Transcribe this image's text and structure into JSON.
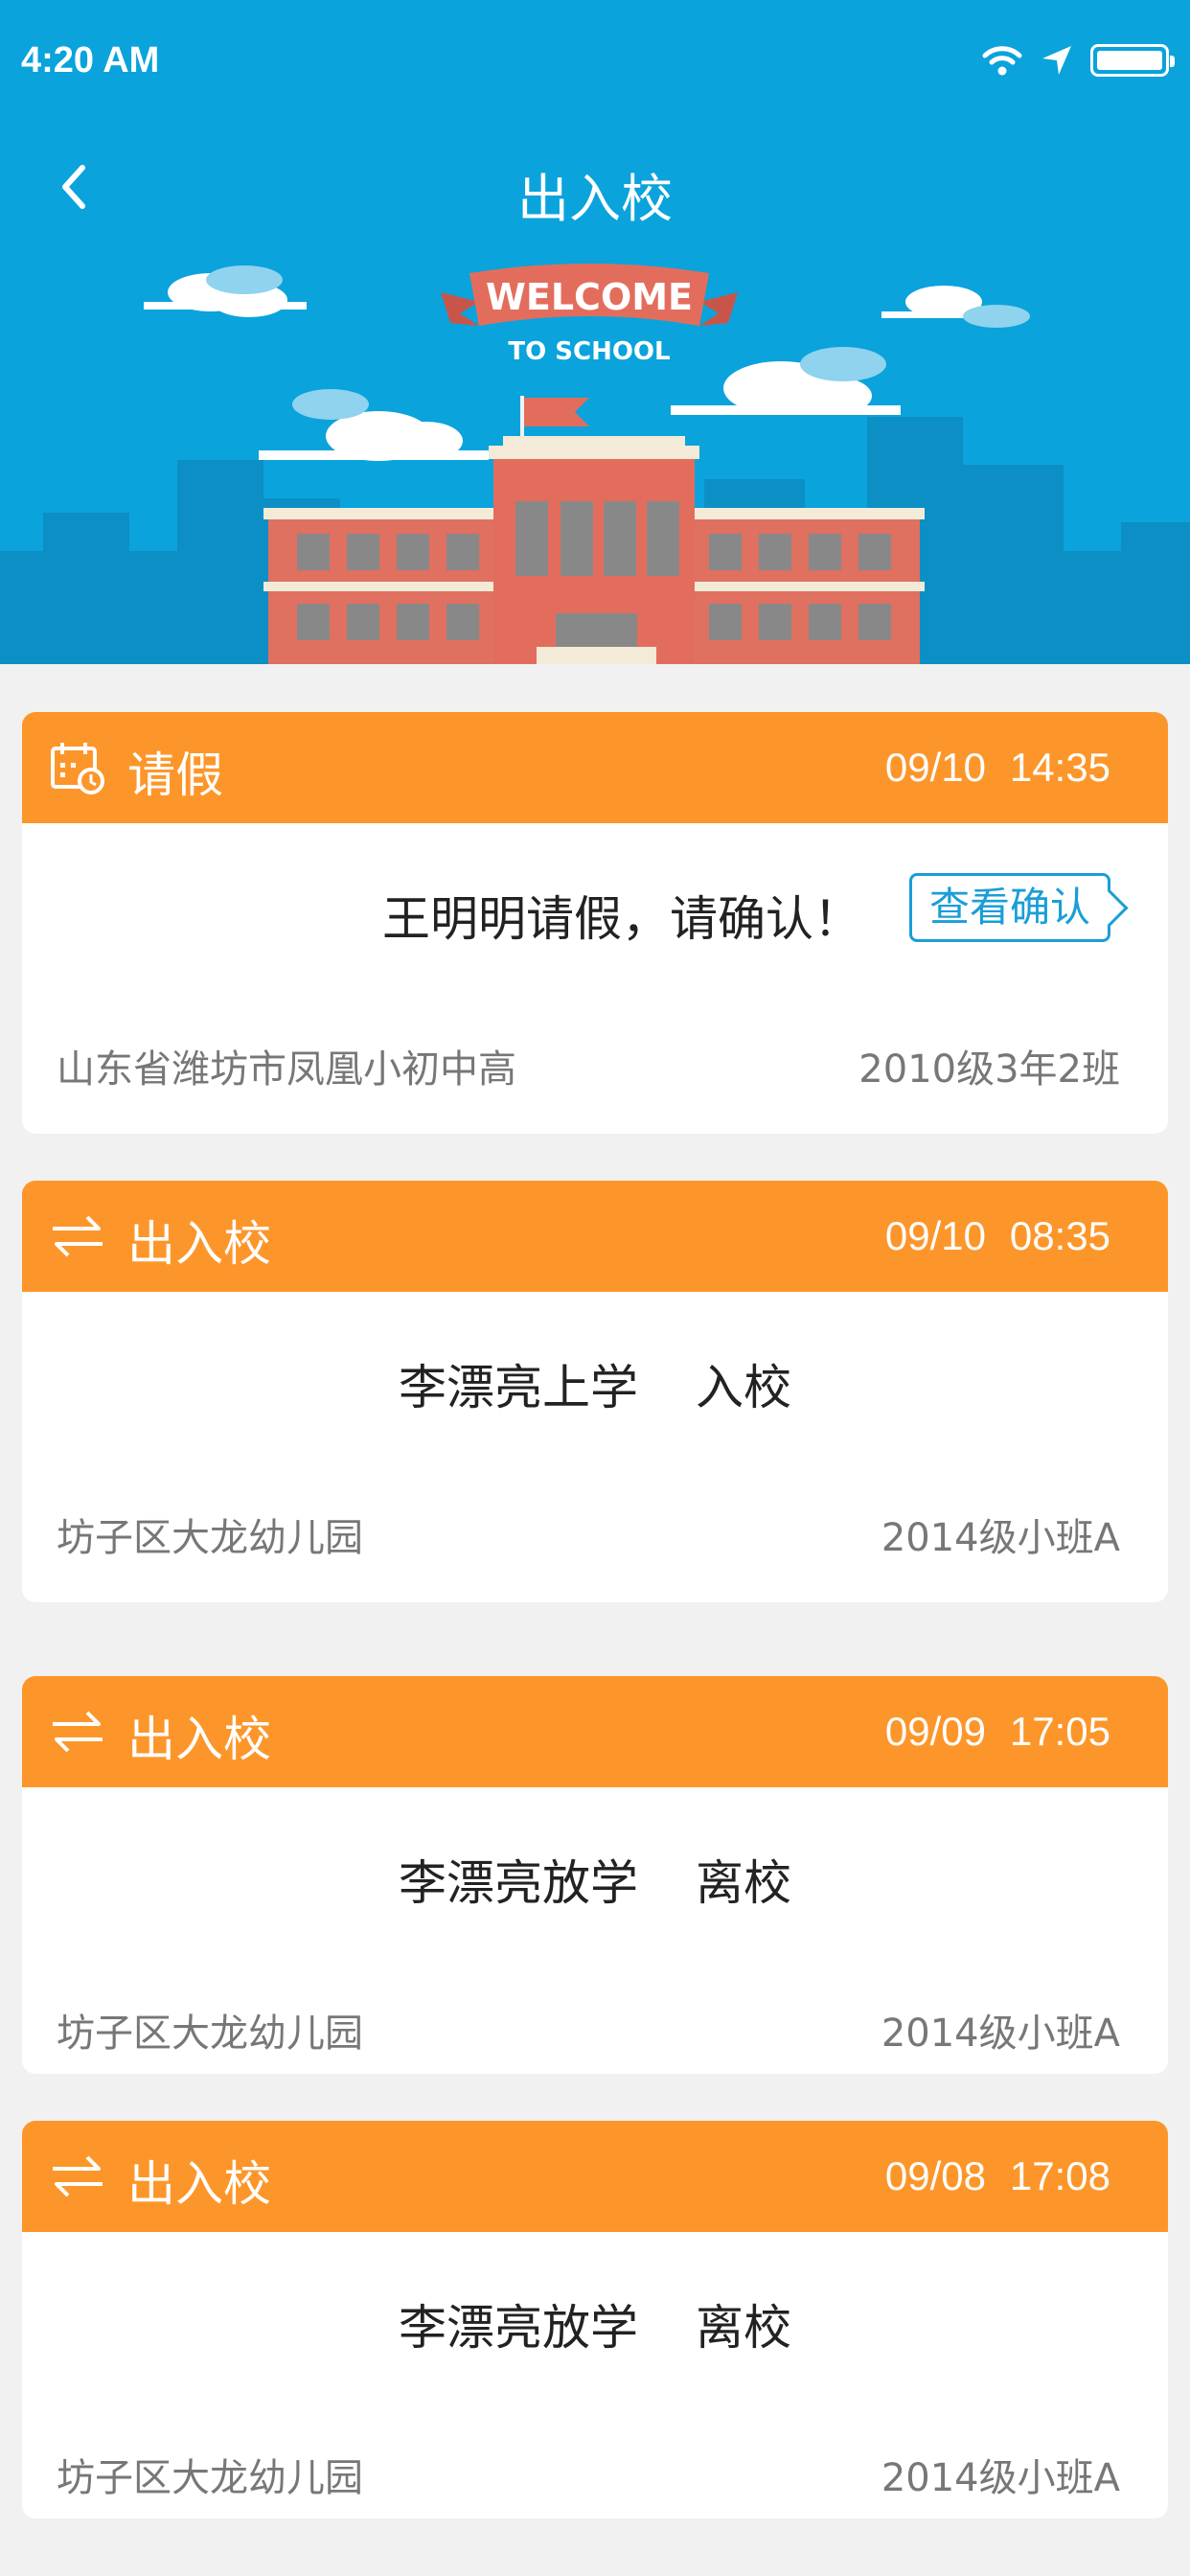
{
  "status_bar": {
    "time": "4:20 AM"
  },
  "nav": {
    "title": "出入校"
  },
  "banner": {
    "welcome": "WELCOME",
    "to_school": "TO SCHOOL"
  },
  "colors": {
    "brand_blue": "#0aa3dc",
    "card_orange": "#fd962a",
    "link_blue": "#1a9ed7",
    "background": "#f1f1f1"
  },
  "cards": [
    {
      "icon": "calendar-clock-icon",
      "type": "请假",
      "date": "09/10",
      "time": "14:35",
      "message": "王明明请假，请确认！",
      "action": "查看确认",
      "school": "山东省潍坊市凤凰小初中高",
      "class": "2010级3年2班"
    },
    {
      "icon": "swap-arrows-icon",
      "type": "出入校",
      "date": "09/10",
      "time": "08:35",
      "student": "李漂亮上学",
      "direction": "入校",
      "school": "坊子区大龙幼儿园",
      "class": "2014级小班A"
    },
    {
      "icon": "swap-arrows-icon",
      "type": "出入校",
      "date": "09/09",
      "time": "17:05",
      "student": "李漂亮放学",
      "direction": "离校",
      "school": "坊子区大龙幼儿园",
      "class": "2014级小班A"
    },
    {
      "icon": "swap-arrows-icon",
      "type": "出入校",
      "date": "09/08",
      "time": "17:08",
      "student": "李漂亮放学",
      "direction": "离校",
      "school": "坊子区大龙幼儿园",
      "class": "2014级小班A"
    }
  ]
}
